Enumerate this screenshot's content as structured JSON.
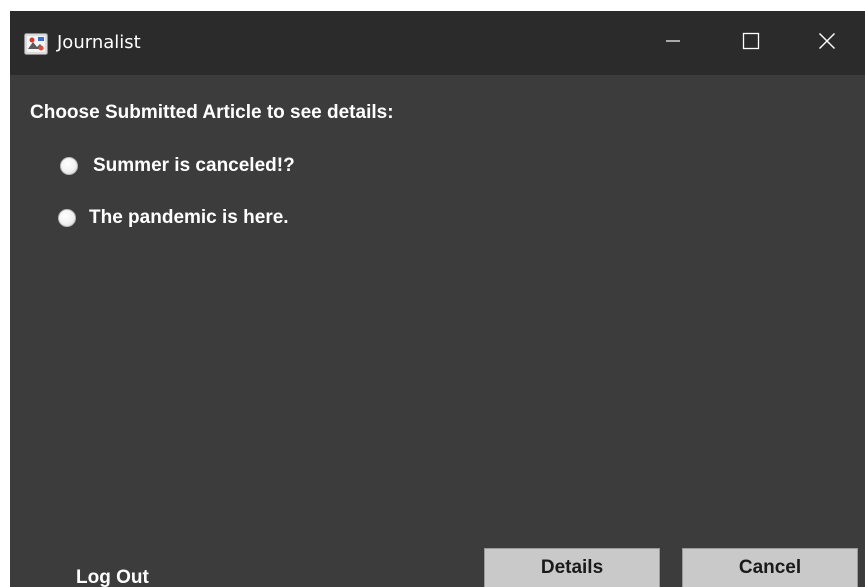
{
  "window": {
    "title": "Journalist"
  },
  "main": {
    "prompt": "Choose Submitted Article to see details:",
    "articles": [
      {
        "label": "Summer is canceled!?"
      },
      {
        "label": "The pandemic is here."
      }
    ]
  },
  "footer": {
    "logout_label": "Log Out",
    "details_label": "Details",
    "cancel_label": "Cancel"
  },
  "icons": {
    "app": "journalist-app-icon",
    "minimize": "minimize-icon",
    "maximize": "maximize-icon",
    "close": "close-icon"
  },
  "colors": {
    "window_bg": "#3c3c3c",
    "titlebar_bg": "#2b2b2b",
    "text": "#ffffff",
    "button_bg": "#c9c9c9"
  }
}
